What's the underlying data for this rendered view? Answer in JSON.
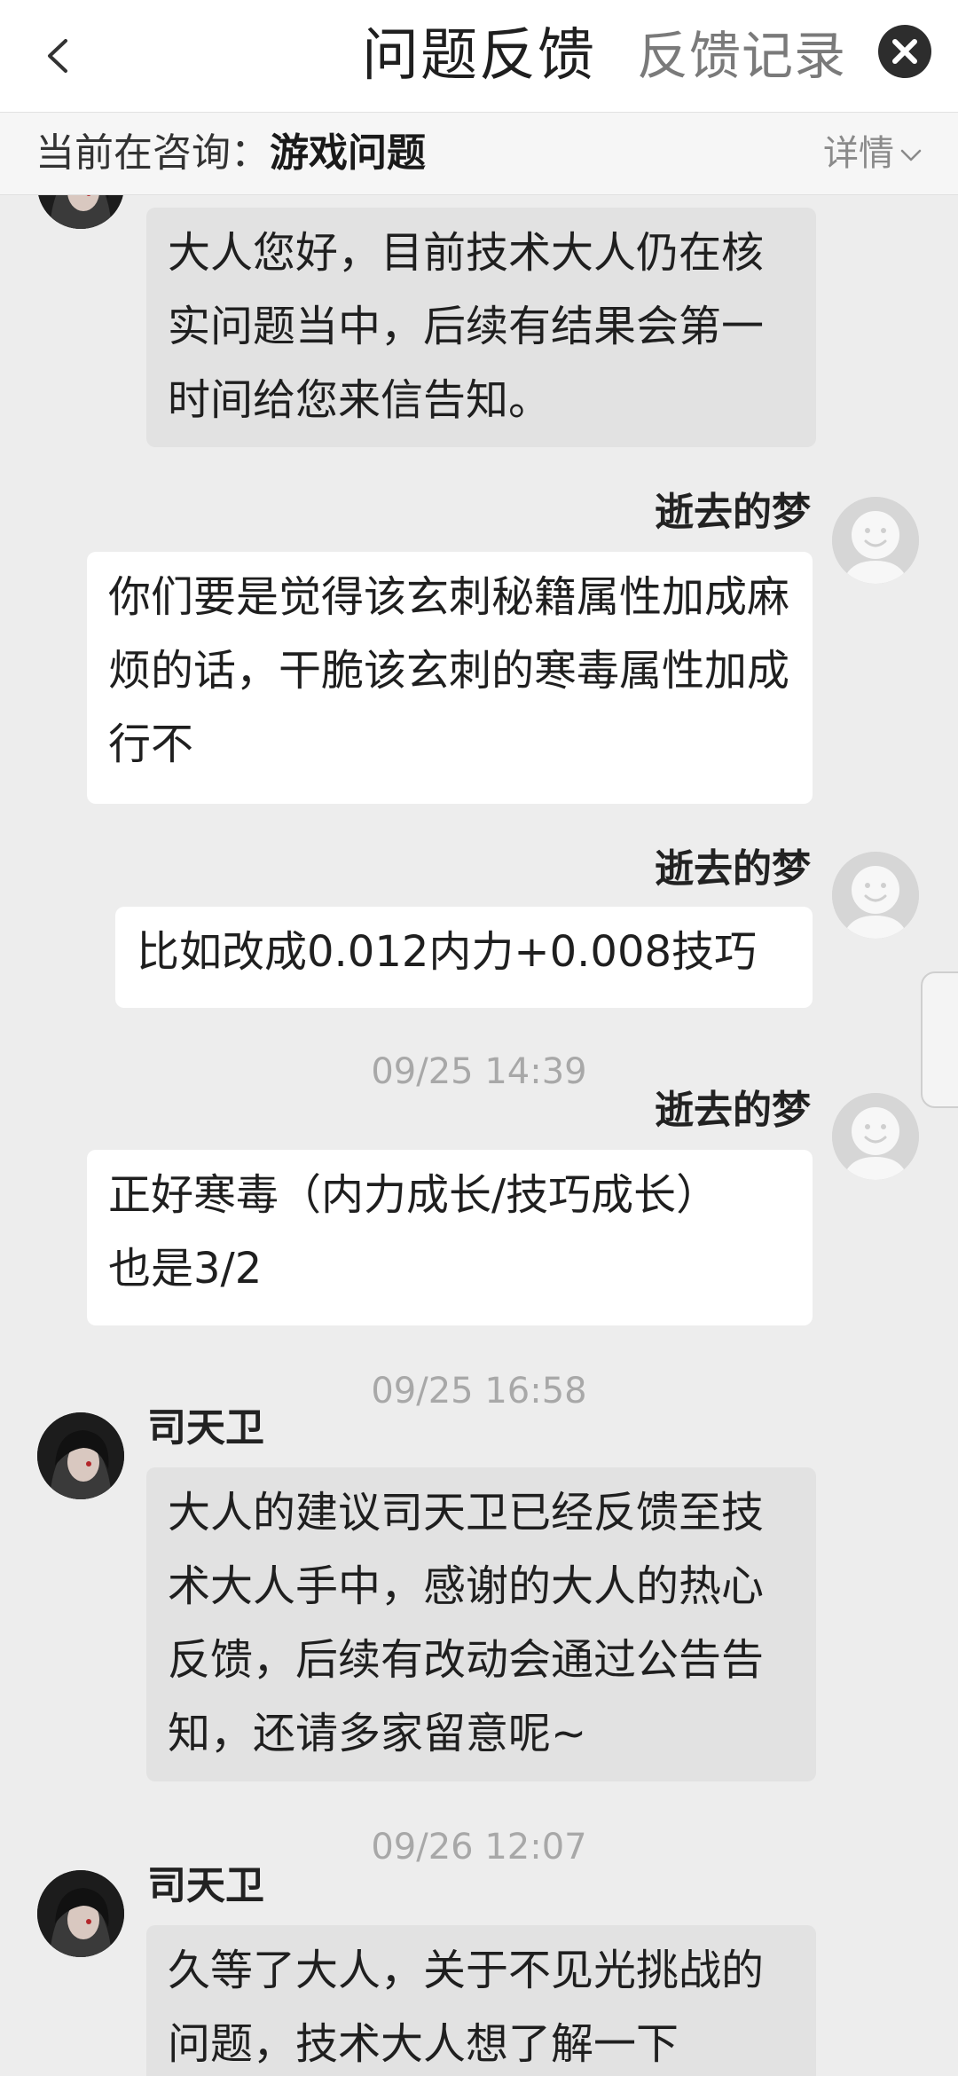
{
  "header": {
    "title": "问题反馈",
    "history_label": "反馈记录",
    "back_icon": "chevron-left-icon",
    "close_icon": "close-icon"
  },
  "consult": {
    "label": "当前在咨询：",
    "value": "游戏问题",
    "detail_label": "详情"
  },
  "colors": {
    "background": "#ededed",
    "agent_bubble": "#e2e2e2",
    "user_bubble": "#ffffff",
    "timestamp": "#a8a8a8"
  },
  "messages": [
    {
      "sender": "agent",
      "name": "",
      "text": "大人您好，目前技术大人仍在核实问题当中，后续有结果会第一时间给您来信告知。"
    },
    {
      "sender": "user",
      "name": "逝去的梦",
      "text": "你们要是觉得该玄刺秘籍属性加成麻烦的话，干脆该玄刺的寒毒属性加成行不"
    },
    {
      "sender": "user",
      "name": "逝去的梦",
      "text": "比如改成0.012内力+0.008技巧"
    },
    {
      "time": "09/25 14:39"
    },
    {
      "sender": "user",
      "name": "逝去的梦",
      "text": "正好寒毒（内力成长/技巧成长）也是3/2"
    },
    {
      "time": "09/25 16:58"
    },
    {
      "sender": "agent",
      "name": "司天卫",
      "text": "大人的建议司天卫已经反馈至技术大人手中，感谢的大人的热心反馈，后续有改动会通过公告告知，还请多家留意呢~"
    },
    {
      "time": "09/26 12:07"
    },
    {
      "sender": "agent",
      "name": "司天卫",
      "text": "久等了大人，关于不见光挑战的问题，技术大人想了解一下"
    }
  ]
}
